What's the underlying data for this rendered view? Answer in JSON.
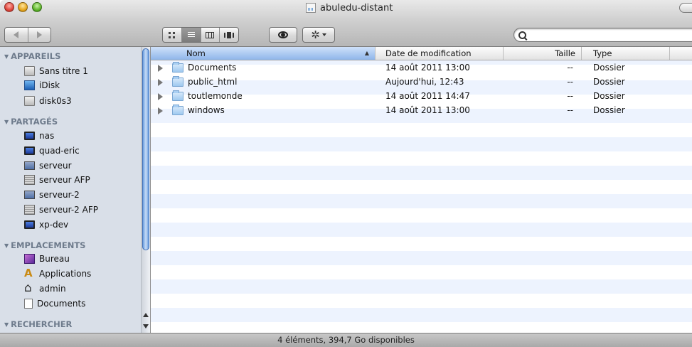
{
  "window": {
    "title": "abuledu-distant"
  },
  "toolbar": {
    "search_placeholder": ""
  },
  "sidebar": {
    "sections": [
      {
        "header": "APPAREILS",
        "items": [
          {
            "label": "Sans titre 1",
            "icon": "drive-icon"
          },
          {
            "label": "iDisk",
            "icon": "idisk-icon"
          },
          {
            "label": "disk0s3",
            "icon": "drive-icon"
          }
        ]
      },
      {
        "header": "PARTAGÉS",
        "items": [
          {
            "label": "nas",
            "icon": "monitor-icon"
          },
          {
            "label": "quad-eric",
            "icon": "monitor-icon"
          },
          {
            "label": "serveur",
            "icon": "server-icon"
          },
          {
            "label": "serveur AFP",
            "icon": "afp-server-icon"
          },
          {
            "label": "serveur-2",
            "icon": "server-icon"
          },
          {
            "label": "serveur-2 AFP",
            "icon": "afp-server-icon"
          },
          {
            "label": "xp-dev",
            "icon": "monitor-icon"
          }
        ]
      },
      {
        "header": "EMPLACEMENTS",
        "items": [
          {
            "label": "Bureau",
            "icon": "desktop-icon"
          },
          {
            "label": "Applications",
            "icon": "applications-icon"
          },
          {
            "label": "admin",
            "icon": "home-icon"
          },
          {
            "label": "Documents",
            "icon": "document-icon"
          }
        ]
      },
      {
        "header": "RECHERCHER",
        "items": []
      }
    ]
  },
  "list": {
    "columns": {
      "name": "Nom",
      "date": "Date de modification",
      "size": "Taille",
      "type": "Type"
    },
    "rows": [
      {
        "name": "Documents",
        "date": "14 août 2011 13:00",
        "size": "--",
        "type": "Dossier"
      },
      {
        "name": "public_html",
        "date": "Aujourd'hui, 12:43",
        "size": "--",
        "type": "Dossier"
      },
      {
        "name": "toutlemonde",
        "date": "14 août 2011 14:47",
        "size": "--",
        "type": "Dossier"
      },
      {
        "name": "windows",
        "date": "14 août 2011 13:00",
        "size": "--",
        "type": "Dossier"
      }
    ]
  },
  "status": {
    "text": "4 éléments, 394,7 Go disponibles"
  }
}
